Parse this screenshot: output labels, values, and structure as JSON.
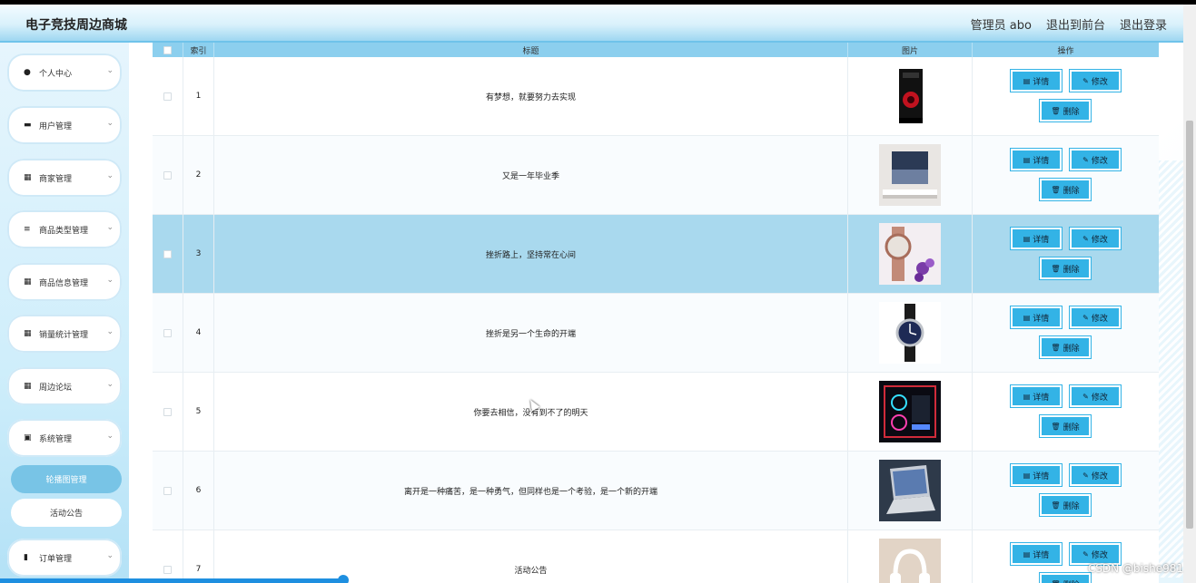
{
  "header": {
    "title": "电子竞技周边商城",
    "user_label": "管理员 abo",
    "front_link": "退出到前台",
    "logout_link": "退出登录"
  },
  "sidebar": {
    "items": [
      {
        "label": "个人中心",
        "icon": "user-icon"
      },
      {
        "label": "用户管理",
        "icon": "monitor-icon"
      },
      {
        "label": "商家管理",
        "icon": "grid-icon"
      },
      {
        "label": "商品类型管理",
        "icon": "list-icon"
      },
      {
        "label": "商品信息管理",
        "icon": "grid-icon"
      },
      {
        "label": "销量统计管理",
        "icon": "grid-icon"
      },
      {
        "label": "周边论坛",
        "icon": "grid-icon"
      },
      {
        "label": "系统管理",
        "icon": "clipboard-icon"
      }
    ],
    "sub_items": [
      {
        "label": "轮播图管理",
        "active": true
      },
      {
        "label": "活动公告",
        "active": false
      }
    ],
    "bottom_item": {
      "label": "订单管理",
      "icon": "bar-chart-icon"
    }
  },
  "table": {
    "headers": [
      "索引",
      "标题",
      "图片",
      "操作"
    ],
    "buttons": {
      "detail": "详情",
      "edit": "修改",
      "delete": "删除"
    },
    "rows": [
      {
        "index": "1",
        "title": "有梦想，就要努力去实现",
        "image": "pc-case"
      },
      {
        "index": "2",
        "title": "又是一年毕业季",
        "image": "poster"
      },
      {
        "index": "3",
        "title": "挫折路上，坚持常在心间",
        "image": "watch-flower"
      },
      {
        "index": "4",
        "title": "挫折是另一个生命的开端",
        "image": "watch"
      },
      {
        "index": "5",
        "title": "你要去相信，没有到不了的明天",
        "image": "rgb-pc"
      },
      {
        "index": "6",
        "title": "离开是一种痛苦，是一种勇气，但同样也是一个考验，是一个新的开端",
        "image": "laptop"
      },
      {
        "index": "7",
        "title": "活动公告",
        "image": "headphones"
      }
    ]
  },
  "watermark": "CSDN @bishe981"
}
